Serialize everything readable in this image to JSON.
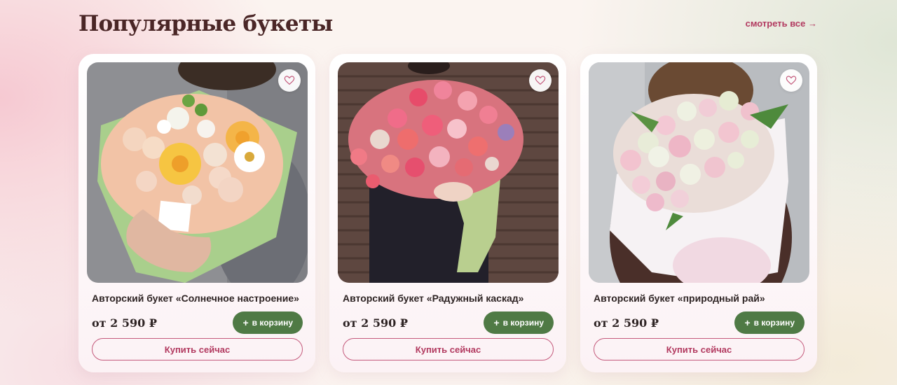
{
  "header": {
    "title": "Популярные букеты",
    "see_all": "смотреть все →"
  },
  "colors": {
    "accent": "#b23a60",
    "cart_button": "#4f7a45",
    "title": "#4a2626"
  },
  "cards": [
    {
      "name": "Авторский букет «Солнечное настроение»",
      "price": "от 2 590 ₽",
      "cart_label": "в корзину",
      "cart_icon": "+",
      "buy_label": "Купить сейчас",
      "favorite_icon": "heart-outline-icon"
    },
    {
      "name": "Авторский букет «Радужный каскад»",
      "price": "от 2 590 ₽",
      "cart_label": "в корзину",
      "cart_icon": "+",
      "buy_label": "Купить сейчас",
      "favorite_icon": "heart-outline-icon"
    },
    {
      "name": "Авторский букет «природный рай»",
      "price": "от 2 590 ₽",
      "cart_label": "в корзину",
      "cart_icon": "+",
      "buy_label": "Купить сейчас",
      "favorite_icon": "heart-outline-icon"
    }
  ]
}
